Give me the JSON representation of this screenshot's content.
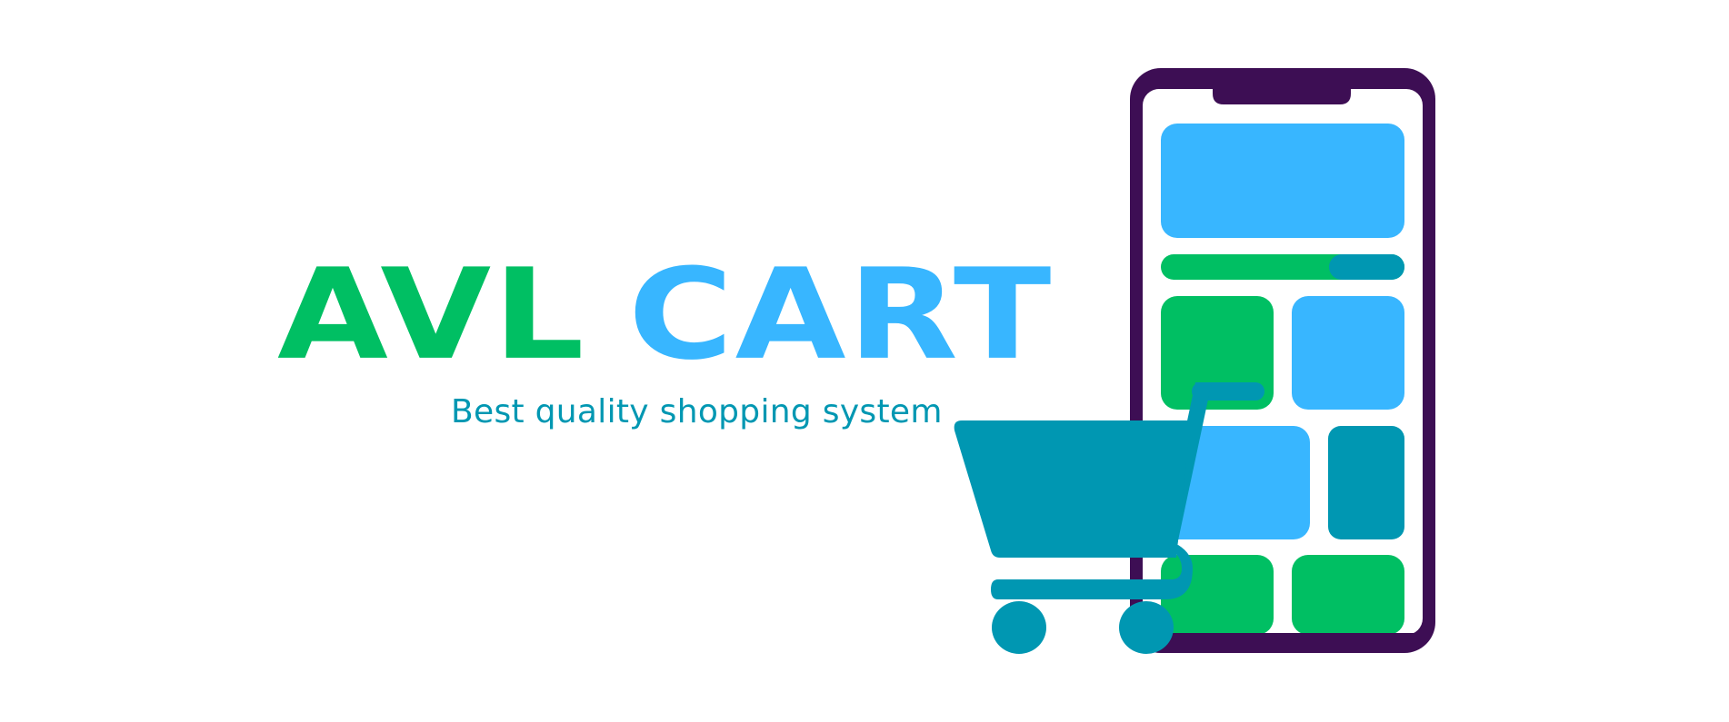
{
  "brand": {
    "word1": "AVL",
    "word2": "CART",
    "tagline": "Best quality shopping system"
  },
  "colors": {
    "green": "#00BF63",
    "sky_blue": "#38B6FF",
    "teal": "#0097B2",
    "purple": "#3D0E54",
    "background": "#FFFFFF"
  },
  "icons": {
    "phone": "smartphone-icon",
    "cart": "shopping-cart-icon"
  }
}
